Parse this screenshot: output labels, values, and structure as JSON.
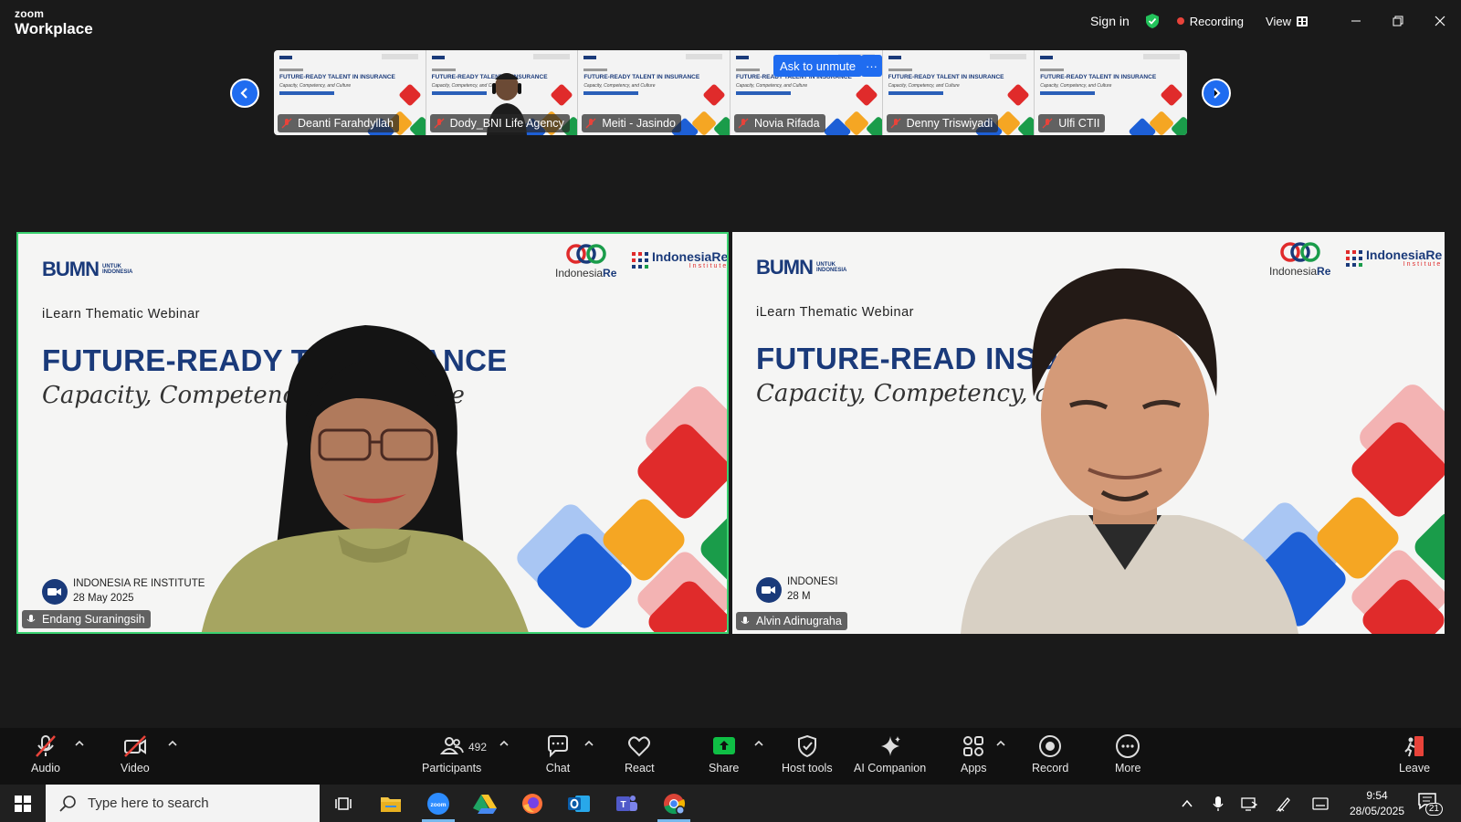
{
  "app": {
    "brand_small": "zoom",
    "brand_big": "Workplace",
    "signin": "Sign in",
    "recording": "Recording",
    "view": "View"
  },
  "strip": {
    "ask_to_unmute": "Ask to unmute",
    "more": "···",
    "slide_title": "FUTURE-READY TALENT IN INSURANCE",
    "slide_sub": "Capacity, Competency, and Culture",
    "participants": [
      {
        "name": "Deanti Farahdyllah"
      },
      {
        "name": "Dody_BNI Life Agency"
      },
      {
        "name": "Meiti - Jasindo"
      },
      {
        "name": "Novia Rifada"
      },
      {
        "name": "Denny Triswiyadi"
      },
      {
        "name": "Ulfi CTII"
      }
    ]
  },
  "tiles": [
    {
      "name": "Endang Suraningsih",
      "bumn": "BUMN",
      "bumn_sub1": "UNTUK",
      "bumn_sub2": "INDONESIA",
      "ire": "Indonesia",
      "ire_b": "Re",
      "inst": "IndonesiaRe",
      "inst_small": "Institute",
      "webinar": "iLearn Thematic Webinar",
      "headline": "FUTURE-READY TAL      SURANCE",
      "script": "Capacity, Competency, and Culture",
      "org": "INDONESIA RE INSTITUTE",
      "date": "28 May 2025"
    },
    {
      "name": "Alvin Adinugraha",
      "bumn": "BUMN",
      "bumn_sub1": "UNTUK",
      "bumn_sub2": "INDONESIA",
      "ire": "Indonesia",
      "ire_b": "Re",
      "inst": "IndonesiaRe",
      "inst_small": "Institute",
      "webinar": "iLearn Thematic Webinar",
      "headline": "FUTURE-READ                INSURANCE",
      "script": "Capacity, Competency, and C",
      "org": "INDONESI",
      "date": "28 M"
    }
  ],
  "toolbar": {
    "audio": "Audio",
    "video": "Video",
    "participants": "Participants",
    "participants_count": "492",
    "chat": "Chat",
    "react": "React",
    "share": "Share",
    "host_tools": "Host tools",
    "ai_companion": "AI Companion",
    "apps": "Apps",
    "record": "Record",
    "more": "More",
    "leave": "Leave"
  },
  "taskbar": {
    "search_placeholder": "Type here to search",
    "time": "9:54",
    "date": "28/05/2025",
    "notifications": "21"
  },
  "colors": {
    "accent": "#1f6cf0",
    "active_speaker": "#3ad170",
    "recording": "#e8433a",
    "share_green": "#0fbf45",
    "slide_blue": "#1a3a7a"
  }
}
